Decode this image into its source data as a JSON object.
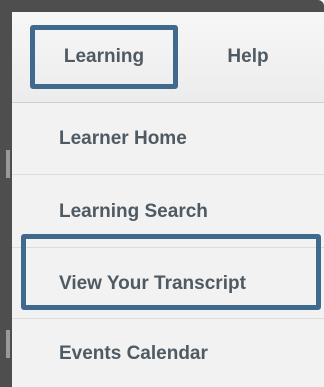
{
  "menubar": {
    "tabs": [
      {
        "label": "Learning"
      },
      {
        "label": "Help"
      }
    ]
  },
  "dropdown": {
    "items": [
      {
        "label": "Learner Home"
      },
      {
        "label": "Learning Search"
      },
      {
        "label": "View Your Transcript"
      },
      {
        "label": "Events Calendar"
      }
    ]
  },
  "highlight_color": "#3f6a8e"
}
